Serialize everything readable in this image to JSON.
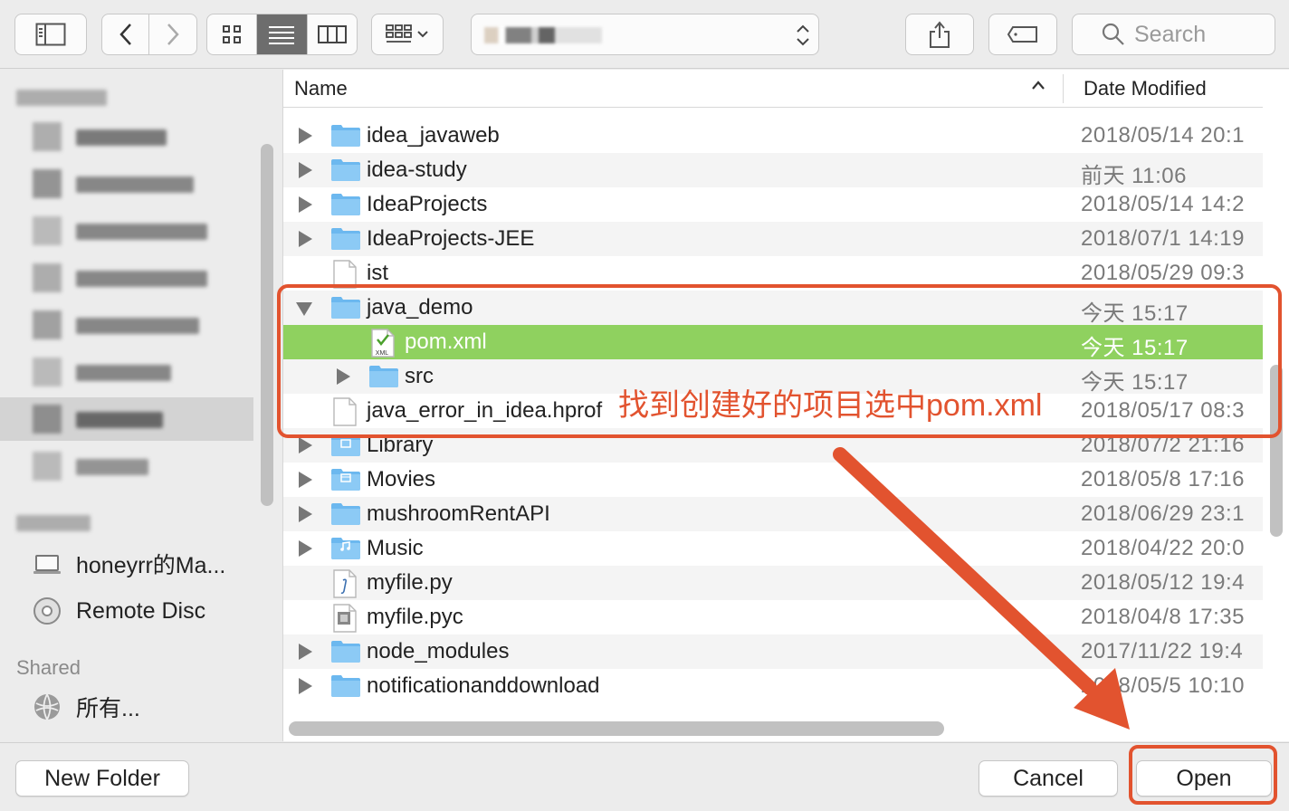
{
  "toolbar": {
    "search_placeholder": "Search",
    "path_label": ""
  },
  "sidebar": {
    "favorites_header": "",
    "devices_header": "",
    "devices": [
      {
        "label": "honeyrr的Ma...",
        "icon": "laptop-icon"
      },
      {
        "label": "Remote Disc",
        "icon": "disc-icon"
      }
    ],
    "shared_header": "Shared",
    "shared": [
      {
        "label": "所有...",
        "icon": "network-globe-icon"
      }
    ]
  },
  "list": {
    "col_name": "Name",
    "col_date": "Date Modified",
    "rows": [
      {
        "name": "idea_javaweb",
        "date": "2018/05/14 20:1",
        "kind": "folder",
        "expand": "right",
        "indent": 0
      },
      {
        "name": "idea-study",
        "date": "前天 11:06",
        "kind": "folder",
        "expand": "right",
        "indent": 0
      },
      {
        "name": "IdeaProjects",
        "date": "2018/05/14 14:2",
        "kind": "folder",
        "expand": "right",
        "indent": 0
      },
      {
        "name": "IdeaProjects-JEE",
        "date": "2018/07/1 14:19",
        "kind": "folder",
        "expand": "right",
        "indent": 0
      },
      {
        "name": "ist",
        "date": "2018/05/29 09:3",
        "kind": "file",
        "expand": "none",
        "indent": 0
      },
      {
        "name": "java_demo",
        "date": "今天 15:17",
        "kind": "folder",
        "expand": "down",
        "indent": 0
      },
      {
        "name": "pom.xml",
        "date": "今天 15:17",
        "kind": "xml",
        "expand": "none",
        "indent": 1,
        "selected": true
      },
      {
        "name": "src",
        "date": "今天 15:17",
        "kind": "folder",
        "expand": "right",
        "indent": 1
      },
      {
        "name": "java_error_in_idea.hprof",
        "date": "2018/05/17 08:3",
        "kind": "file",
        "expand": "none",
        "indent": 0
      },
      {
        "name": "Library",
        "date": "2018/07/2 21:16",
        "kind": "library",
        "expand": "right",
        "indent": 0
      },
      {
        "name": "Movies",
        "date": "2018/05/8 17:16",
        "kind": "movies",
        "expand": "right",
        "indent": 0
      },
      {
        "name": "mushroomRentAPI",
        "date": "2018/06/29 23:1",
        "kind": "folder",
        "expand": "right",
        "indent": 0
      },
      {
        "name": "Music",
        "date": "2018/04/22 20:0",
        "kind": "music",
        "expand": "right",
        "indent": 0
      },
      {
        "name": "myfile.py",
        "date": "2018/05/12 19:4",
        "kind": "py",
        "expand": "none",
        "indent": 0
      },
      {
        "name": "myfile.pyc",
        "date": "2018/04/8 17:35",
        "kind": "pyc",
        "expand": "none",
        "indent": 0
      },
      {
        "name": "node_modules",
        "date": "2017/11/22 19:4",
        "kind": "folder",
        "expand": "right",
        "indent": 0
      },
      {
        "name": "notificationanddownload",
        "date": "2018/05/5 10:10",
        "kind": "folder",
        "expand": "right",
        "indent": 0
      }
    ]
  },
  "annotation": {
    "text": "找到创建好的项目选中pom.xml",
    "color": "#e2532f"
  },
  "buttons": {
    "new_folder": "New Folder",
    "cancel": "Cancel",
    "open": "Open"
  },
  "colors": {
    "selection": "#8fd15f",
    "folder": "#6cb8ef",
    "annotation": "#e2532f"
  }
}
